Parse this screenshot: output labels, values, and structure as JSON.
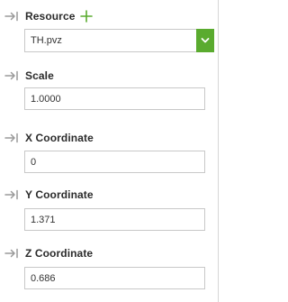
{
  "resource": {
    "label": "Resource",
    "value": "TH.pvz"
  },
  "scale": {
    "label": "Scale",
    "value": "1.0000"
  },
  "x_coordinate": {
    "label": "X Coordinate",
    "value": "0"
  },
  "y_coordinate": {
    "label": "Y Coordinate",
    "value": "1.371"
  },
  "z_coordinate": {
    "label": "Z Coordinate",
    "value": "0.686"
  },
  "colors": {
    "accent_green": "#5aab2f",
    "arrow_gray": "#9a9a9a",
    "border": "#c8c8c8"
  },
  "icons": {
    "link_arrow": "arrow-into-bar-icon",
    "add": "plus-icon",
    "dropdown": "chevron-down-icon"
  }
}
